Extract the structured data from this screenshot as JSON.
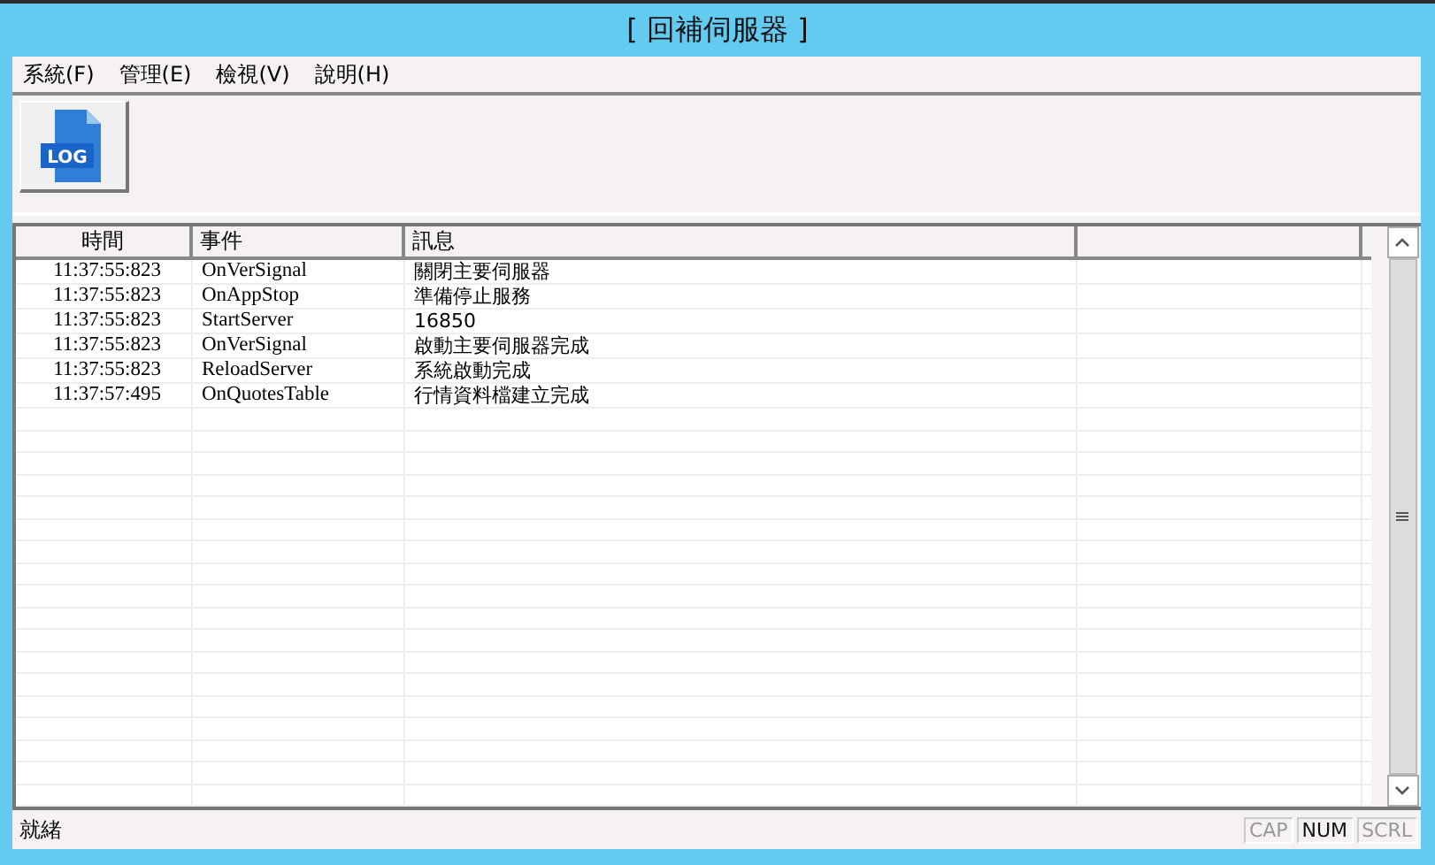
{
  "window": {
    "title": "[ 回補伺服器 ]"
  },
  "menu": [
    "系統(F)",
    "管理(E)",
    "檢視(V)",
    "說明(H)"
  ],
  "toolbar": {
    "buttons": [
      {
        "label": "LOG"
      }
    ]
  },
  "table": {
    "columns": [
      "時間",
      "事件",
      "訊息"
    ],
    "rows": [
      {
        "time": "11:37:55:823",
        "event": "OnVerSignal",
        "message": "關閉主要伺服器"
      },
      {
        "time": "11:37:55:823",
        "event": "OnAppStop",
        "message": "準備停止服務"
      },
      {
        "time": "11:37:55:823",
        "event": "StartServer",
        "message": "16850"
      },
      {
        "time": "11:37:55:823",
        "event": "OnVerSignal",
        "message": "啟動主要伺服器完成"
      },
      {
        "time": "11:37:55:823",
        "event": "ReloadServer",
        "message": "系統啟動完成"
      },
      {
        "time": "11:37:57:495",
        "event": "OnQuotesTable",
        "message": "行情資料檔建立完成"
      }
    ]
  },
  "status_bar": {
    "text": "就緒",
    "indicators": [
      {
        "label": "CAP",
        "on": false
      },
      {
        "label": "NUM",
        "on": true
      },
      {
        "label": "SCRL",
        "on": false
      }
    ]
  }
}
